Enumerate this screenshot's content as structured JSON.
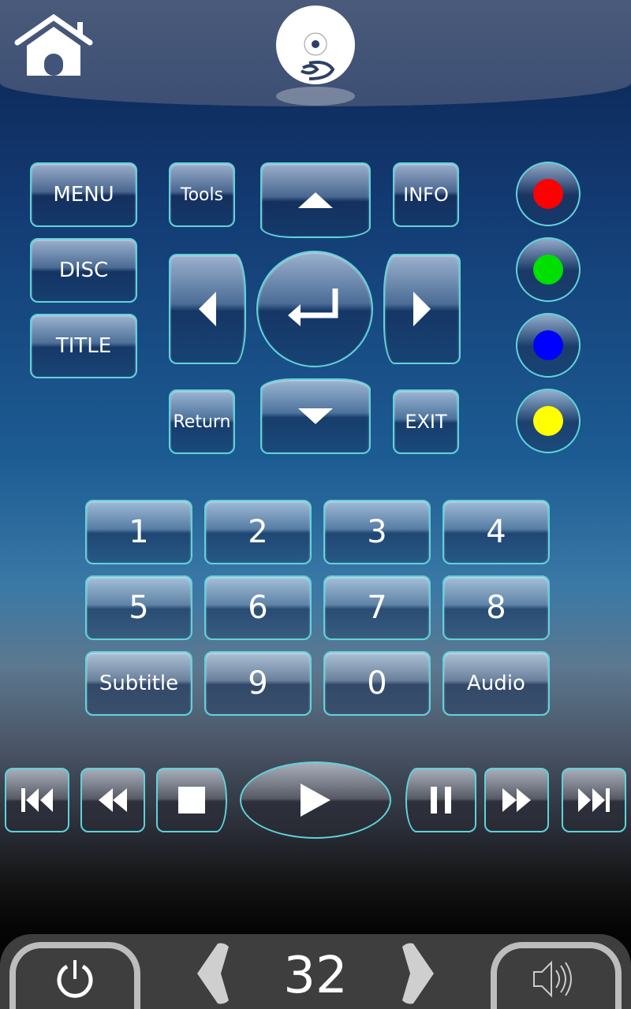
{
  "header": {
    "home_icon": "home-icon",
    "disc_icon": "bluray-disc-icon"
  },
  "menu_buttons": {
    "menu": "MENU",
    "disc": "DISC",
    "title": "TITLE",
    "tools": "Tools",
    "info": "INFO",
    "return": "Return",
    "exit": "EXIT"
  },
  "color_buttons": [
    "#ff0000",
    "#00e000",
    "#0000ff",
    "#ffff00"
  ],
  "numpad": [
    "1",
    "2",
    "3",
    "4",
    "5",
    "6",
    "7",
    "8",
    "Subtitle",
    "9",
    "0",
    "Audio"
  ],
  "transport": [
    "skip-previous-icon",
    "rewind-icon",
    "stop-icon",
    "play-icon",
    "pause-icon",
    "fast-forward-icon",
    "skip-next-icon"
  ],
  "bottom": {
    "channel": "32",
    "power_icon": "power-icon",
    "volume_icon": "volume-icon"
  },
  "colors": {
    "accent_border": "#5fd3da"
  }
}
